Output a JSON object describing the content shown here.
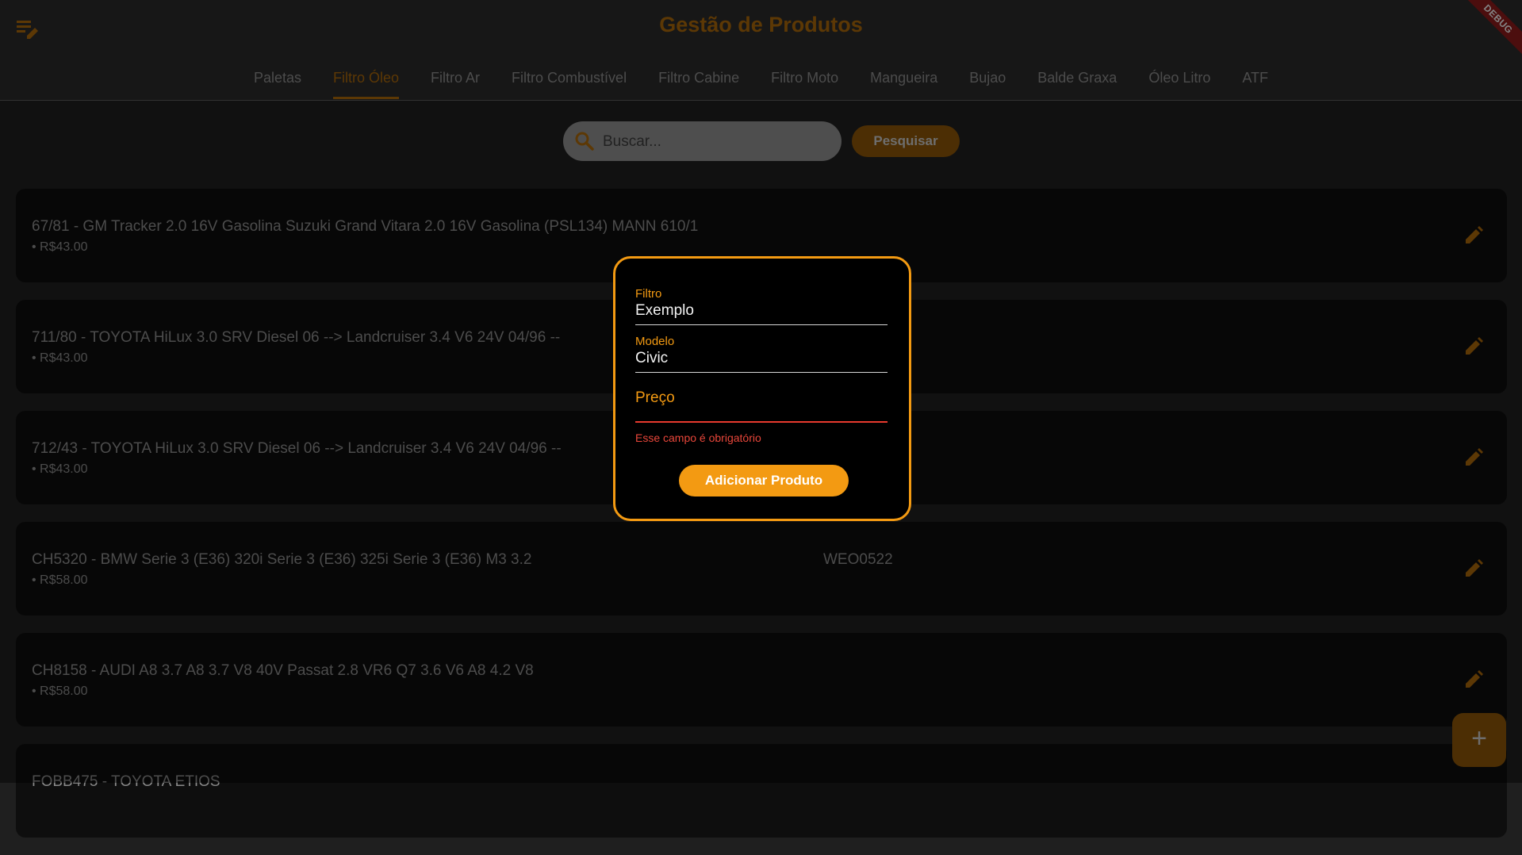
{
  "header": {
    "title": "Gestão de Produtos",
    "menu_icon": "edit-list-icon",
    "debug_label": "DEBUG"
  },
  "tabs": [
    {
      "label": "Paletas",
      "active": false
    },
    {
      "label": "Filtro Óleo",
      "active": true
    },
    {
      "label": "Filtro Ar",
      "active": false
    },
    {
      "label": "Filtro Combustível",
      "active": false
    },
    {
      "label": "Filtro Cabine",
      "active": false
    },
    {
      "label": "Filtro Moto",
      "active": false
    },
    {
      "label": "Mangueira",
      "active": false
    },
    {
      "label": "Bujao",
      "active": false
    },
    {
      "label": "Balde Graxa",
      "active": false
    },
    {
      "label": "Óleo Litro",
      "active": false
    },
    {
      "label": "ATF",
      "active": false
    }
  ],
  "search": {
    "placeholder": "Buscar...",
    "button_label": "Pesquisar"
  },
  "products": [
    {
      "title": "67/81 - GM Tracker 2.0 16V Gasolina Suzuki Grand Vitara 2.0 16V Gasolina  (PSL134) MANN 610/1",
      "price": "• R$43.00",
      "extra": ""
    },
    {
      "title": "711/80 - TOYOTA HiLux 3.0 SRV Diesel 06 --> Landcruiser 3.4 V6 24V 04/96 --",
      "price": "• R$43.00",
      "extra": ""
    },
    {
      "title": "712/43 - TOYOTA HiLux 3.0 SRV Diesel 06 --> Landcruiser 3.4 V6 24V 04/96 --",
      "price": "• R$43.00",
      "extra": ""
    },
    {
      "title": "CH5320 - BMW Serie 3 (E36) 320i Serie 3 (E36) 325i Serie 3 (E36) M3 3.2",
      "price": "• R$58.00",
      "extra": "WEO0522"
    },
    {
      "title": "CH8158 - AUDI A8 3.7 A8 3.7 V8 40V Passat 2.8 VR6 Q7 3.6 V6 A8 4.2 V8",
      "price": "• R$58.00",
      "extra": ""
    },
    {
      "title": "FOBB475 - TOYOTA ETIOS",
      "price": "",
      "extra": ""
    }
  ],
  "dialog": {
    "filtro_label": "Filtro",
    "filtro_value": "Exemplo",
    "modelo_label": "Modelo",
    "modelo_value": "Civic",
    "preco_label": "Preço",
    "preco_error": "Esse campo é obrigatório",
    "submit_label": "Adicionar Produto"
  },
  "fab_icon": "plus-icon",
  "colors": {
    "accent": "#f39a12",
    "accent_dim": "#a8660a",
    "error": "#e8463a"
  }
}
